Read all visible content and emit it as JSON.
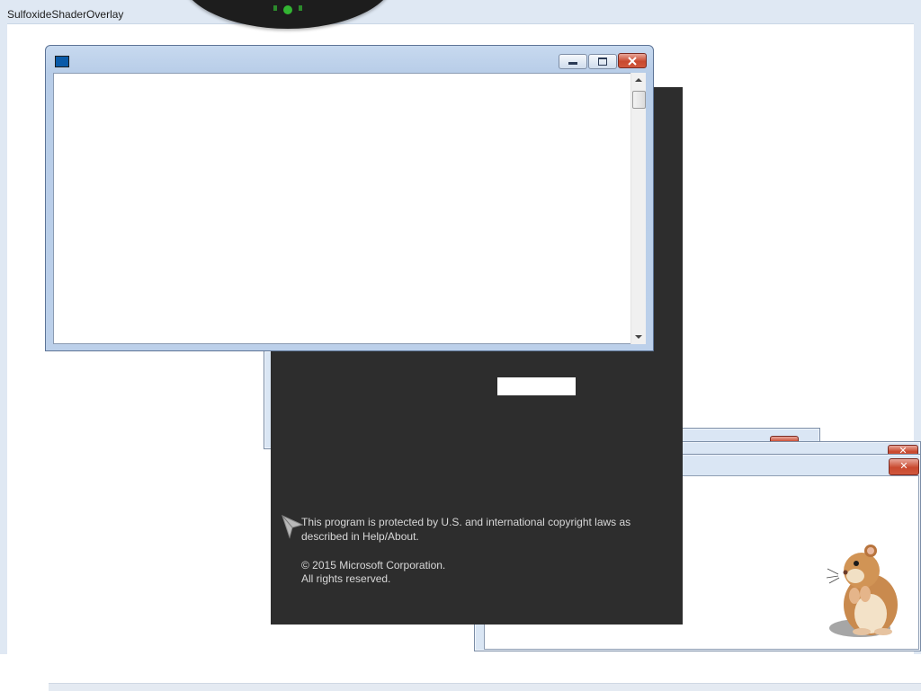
{
  "overlay_window": {
    "title": "SulfoxideShaderOverlay"
  },
  "main_window": {
    "title": "",
    "buttons": {
      "minimize": "minimize-button",
      "maximize": "maximize-button",
      "close": "close-button"
    }
  },
  "splash": {
    "legal_line_1": "This program is protected by U.S. and international copyright laws as",
    "legal_line_2": "described in Help/About.",
    "copyright_line_1": "© 2015 Microsoft Corporation.",
    "copyright_line_2": "All rights reserved."
  },
  "back_windows": [
    {
      "close_label": "✕"
    },
    {
      "close_label": "✕"
    }
  ],
  "colors": {
    "splash_background": "#2d2d2d",
    "close_red": "#c9492f",
    "window_frame": "#dae6f4"
  },
  "icons": [
    "app-icon",
    "pointer-cursor-icon",
    "hamster-mascot",
    "scroll-up-icon",
    "scroll-down-icon"
  ]
}
